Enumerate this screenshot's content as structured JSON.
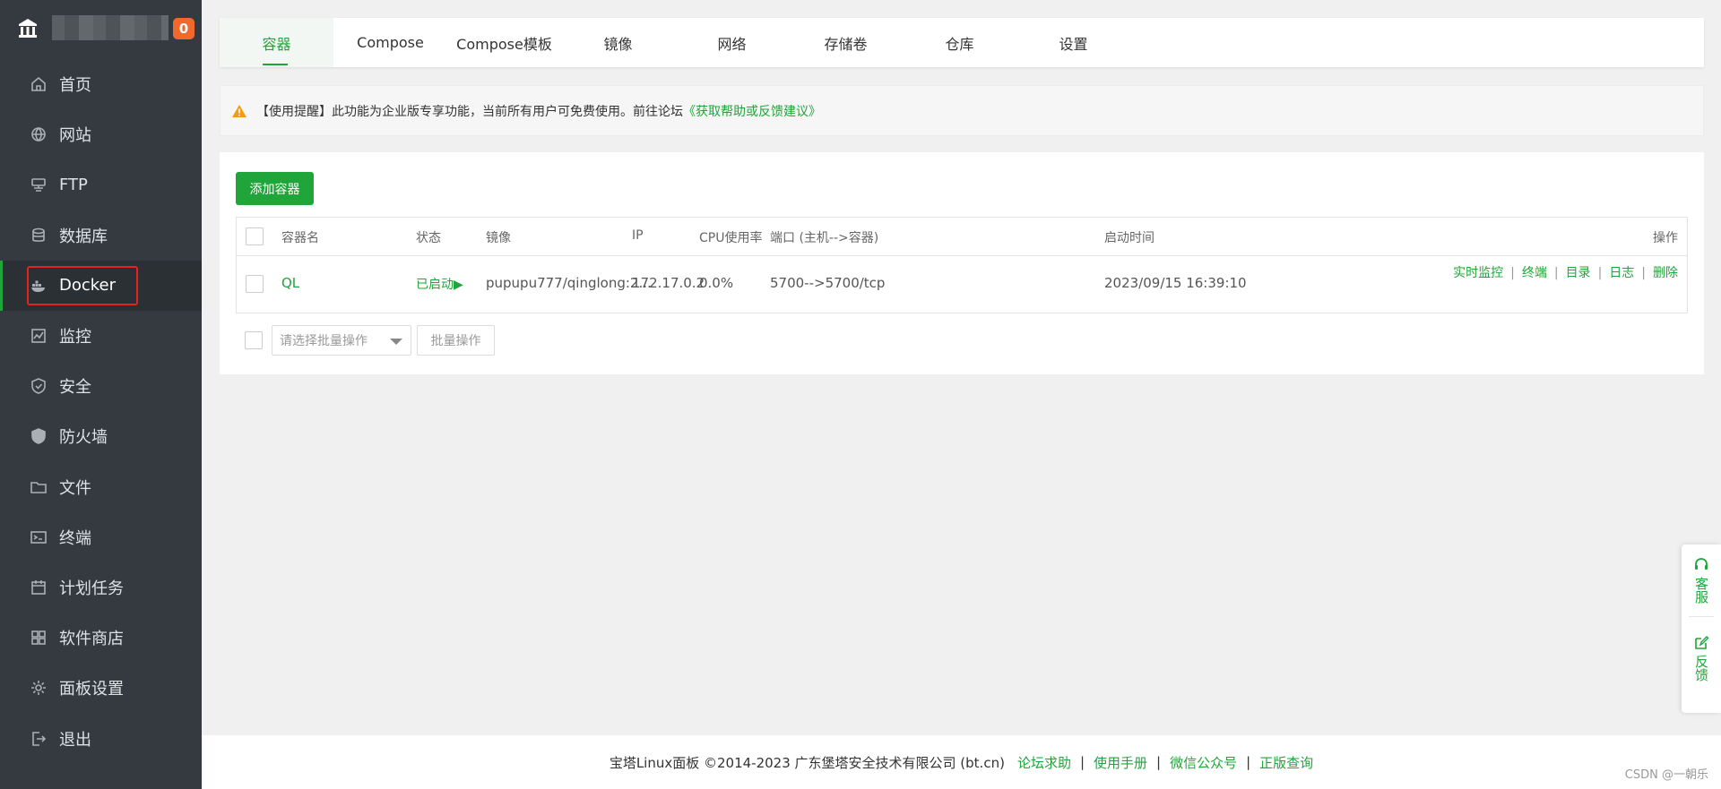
{
  "sidebar": {
    "badge": "0",
    "items": [
      {
        "label": "首页",
        "icon": "home-icon"
      },
      {
        "label": "网站",
        "icon": "globe-icon"
      },
      {
        "label": "FTP",
        "icon": "ftp-icon"
      },
      {
        "label": "数据库",
        "icon": "database-icon"
      },
      {
        "label": "Docker",
        "icon": "docker-icon",
        "active": true
      },
      {
        "label": "监控",
        "icon": "monitor-icon"
      },
      {
        "label": "安全",
        "icon": "shield-icon"
      },
      {
        "label": "防火墙",
        "icon": "firewall-icon"
      },
      {
        "label": "文件",
        "icon": "folder-icon"
      },
      {
        "label": "终端",
        "icon": "terminal-icon"
      },
      {
        "label": "计划任务",
        "icon": "calendar-icon"
      },
      {
        "label": "软件商店",
        "icon": "grid-icon"
      },
      {
        "label": "面板设置",
        "icon": "gear-icon"
      },
      {
        "label": "退出",
        "icon": "logout-icon"
      }
    ]
  },
  "tabs": [
    "容器",
    "Compose",
    "Compose模板",
    "镜像",
    "网络",
    "存储卷",
    "仓库",
    "设置"
  ],
  "notice": {
    "text": "【使用提醒】此功能为企业版专享功能，当前所有用户可免费使用。前往论坛",
    "link": "《获取帮助或反馈建议》"
  },
  "panel": {
    "add_button": "添加容器",
    "headers": {
      "name": "容器名",
      "status": "状态",
      "image": "镜像",
      "ip": "IP",
      "cpu": "CPU使用率",
      "port": "端口 (主机-->容器)",
      "start_time": "启动时间",
      "ops": "操作"
    },
    "row": {
      "name": "QL",
      "status": "已启动▶",
      "image": "pupupu777/qinglong:2...",
      "ip": "172.17.0.2",
      "cpu": "0.0%",
      "port": "5700-->5700/tcp",
      "start_time": "2023/09/15 16:39:10",
      "ops": {
        "monitor": "实时监控",
        "terminal": "终端",
        "dir": "目录",
        "log": "日志",
        "delete": "删除"
      }
    },
    "batch_placeholder": "请选择批量操作",
    "batch_button": "批量操作"
  },
  "footer": {
    "copyright": "宝塔Linux面板 ©2014-2023 广东堡塔安全技术有限公司 (bt.cn)",
    "links": [
      "论坛求助",
      "使用手册",
      "微信公众号",
      "正版查询"
    ]
  },
  "float": {
    "service": "客服",
    "feedback": "反馈"
  },
  "watermark": "CSDN @一朝乐",
  "colors": {
    "brand": "#20a53a",
    "sidebar_bg": "#343a40",
    "badge": "#f0682b",
    "highlight_box": "#e1251b"
  }
}
